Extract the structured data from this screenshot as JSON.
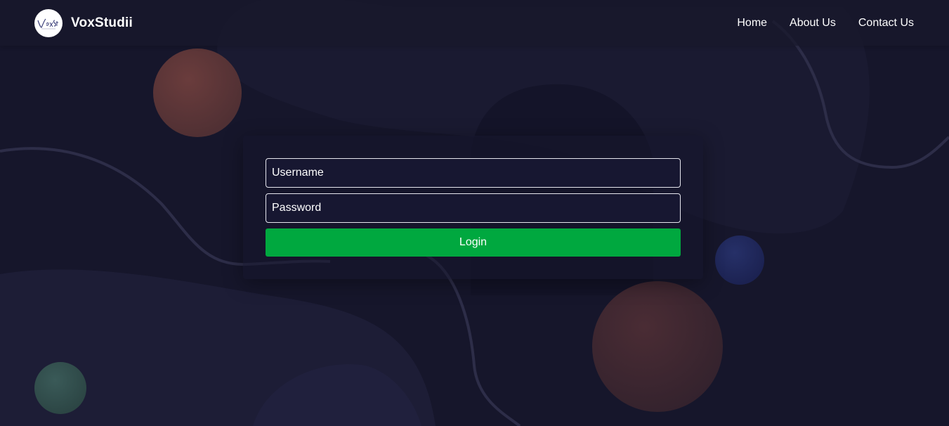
{
  "brand": {
    "name": "VoxStudii",
    "logo_icon": "voxstudii-logo-icon"
  },
  "nav": {
    "links": [
      "Home",
      "About Us",
      "Contact Us"
    ]
  },
  "login": {
    "username_placeholder": "Username",
    "password_placeholder": "Password",
    "button_label": "Login"
  },
  "colors": {
    "background": "#16162b",
    "button": "#00a83f",
    "text": "#ffffff"
  }
}
